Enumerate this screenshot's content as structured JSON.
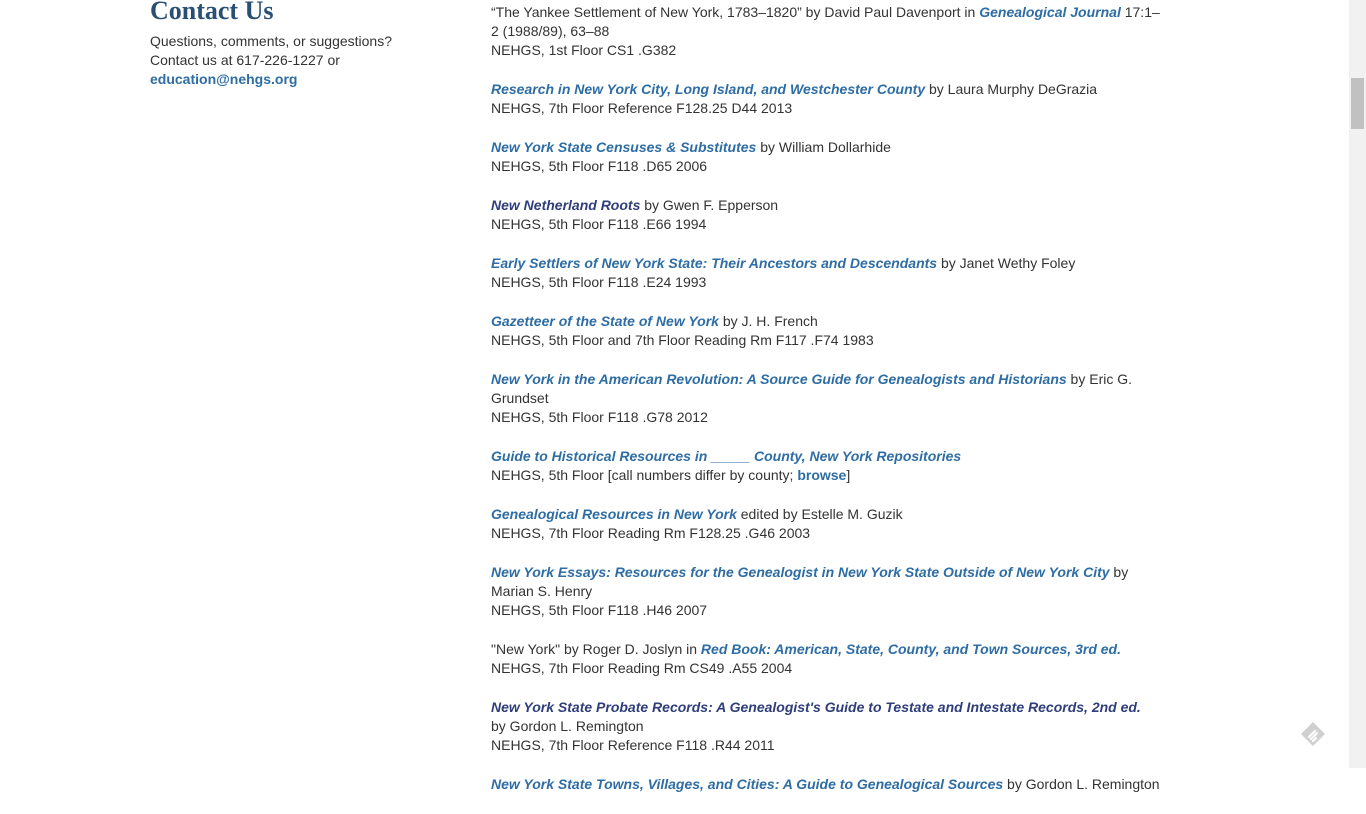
{
  "sidebar": {
    "title": "Contact Us",
    "line1": "Questions, comments, or suggestions?",
    "line2": "Contact us at 617-226-1227 or",
    "email": "education@nehgs.org"
  },
  "entries": [
    {
      "pre": "“The Yankee Settlement of New York, 1783–1820” by David Paul Davenport in ",
      "title": "Genealogical Journal",
      "post": " 17:1–2 (1988/89), 63–88",
      "location": "NEHGS, 1st Floor CS1 .G382"
    },
    {
      "title": "Research in New York City, Long Island, and Westchester County",
      "post": " by Laura Murphy DeGrazia",
      "location": "NEHGS, 7th Floor Reference F128.25 D44 2013"
    },
    {
      "title": "New York State Censuses & Substitutes",
      "post": " by William Dollarhide",
      "location": "NEHGS, 5th Floor F118 .D65 2006"
    },
    {
      "title": "New Netherland Roots",
      "post": " by Gwen F. Epperson",
      "location": "NEHGS, 5th Floor F118 .E66 1994"
    },
    {
      "title": "Early Settlers of New York State: Their Ancestors and Descendants",
      "post": " by Janet Wethy Foley",
      "location": "NEHGS, 5th Floor F118 .E24 1993"
    },
    {
      "title": "Gazetteer of the State of New York",
      "post": " by J. H. French",
      "location": "NEHGS, 5th Floor and 7th Floor Reading Rm F117 .F74 1983"
    },
    {
      "title": "New York in the American Revolution: A Source Guide for Genealogists and Historians",
      "post": " by Eric G. Grundset",
      "location": "NEHGS, 5th Floor F118 .G78 2012"
    },
    {
      "title": "Guide to Historical Resources in _____ County, New York Repositories",
      "location_pre": "NEHGS, 5th Floor [call numbers differ by county; ",
      "location_link": "browse",
      "location_post": "]"
    },
    {
      "title": "Genealogical Resources in New York",
      "post": " edited by Estelle M. Guzik",
      "location": "NEHGS, 7th Floor Reading Rm F128.25 .G46 2003"
    },
    {
      "title": "New York Essays: Resources for the Genealogist in New York State Outside of New York City",
      "post": " by Marian S. Henry",
      "location": "NEHGS, 5th Floor F118 .H46 2007"
    },
    {
      "pre": "\"New York\" by Roger D. Joslyn in ",
      "title": "Red Book: American, State, County, and Town Sources, 3rd ed.",
      "location": "NEHGS, 7th Floor Reading Rm CS49 .A55 2004"
    },
    {
      "title": "New York State Probate Records: A Genealogist's Guide to Testate and Intestate Records, 2nd ed.",
      "author_line": "by Gordon L. Remington",
      "location": "NEHGS, 7th Floor Reference F118 .R44 2011"
    },
    {
      "title": "New York State Towns, Villages, and Cities: A Guide to Genealogical Sources",
      "post": " by Gordon L. Remington"
    }
  ],
  "colors": {
    "link": "#2e6da4",
    "visited_link": "#2f3e7a",
    "heading": "#2a4f74",
    "text": "#333333"
  },
  "icons": {
    "floating_button": "feedly-icon"
  }
}
